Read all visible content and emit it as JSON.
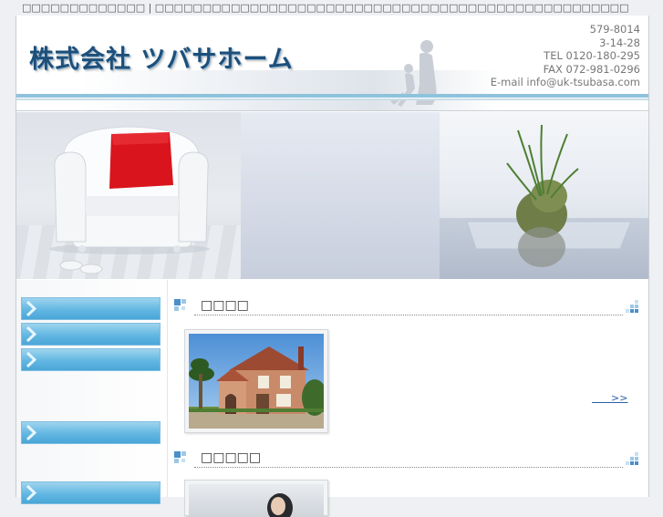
{
  "topbar": {
    "text": "□□□□□□□□□□□□□ | □□□□□□□□□□□□□□□□□□□□□□□□□□□□□□□□□□□□□□□□□□□□□□□□□□"
  },
  "header": {
    "logo": "株式会社 ツバサホーム",
    "contact": {
      "postal": "579-8014",
      "address": "3-14-28",
      "tel": "TEL 0120-180-295",
      "fax": "FAX 072-981-0296",
      "email": "E-mail info@uk-tsubasa.com"
    }
  },
  "sidebar": {
    "items": [
      "",
      "",
      "",
      "",
      ""
    ]
  },
  "sections": [
    {
      "title": "□□□□",
      "more": "      >>"
    },
    {
      "title": "□□□□□"
    }
  ],
  "colors": {
    "accent": "#63b7e2",
    "header_line": "#8ec2dc",
    "logo": "#1d4f7a",
    "link": "#2a62a8"
  }
}
